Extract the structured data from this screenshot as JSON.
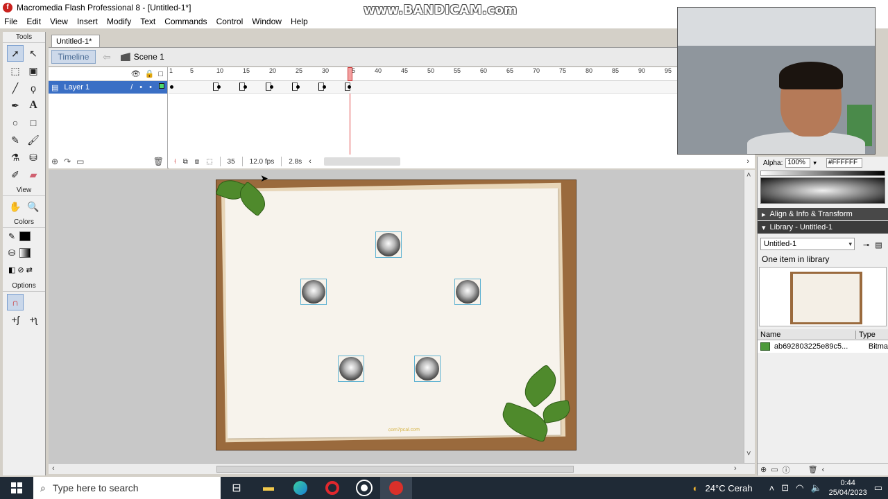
{
  "window": {
    "title": "Macromedia Flash Professional 8 - [Untitled-1*]",
    "watermark": "www.BANDICAM.com"
  },
  "menu": [
    "File",
    "Edit",
    "View",
    "Insert",
    "Modify",
    "Text",
    "Commands",
    "Control",
    "Window",
    "Help"
  ],
  "tools": {
    "label": "Tools",
    "view_label": "View",
    "colors_label": "Colors",
    "options_label": "Options"
  },
  "document": {
    "tab": "Untitled-1*",
    "timeline_button": "Timeline",
    "scene": "Scene 1"
  },
  "timeline": {
    "layer_name": "Layer 1",
    "ruler": [
      "1",
      "5",
      "10",
      "15",
      "20",
      "25",
      "30",
      "35",
      "40",
      "45",
      "50",
      "55",
      "60",
      "65",
      "70",
      "75",
      "80",
      "85",
      "90",
      "95"
    ],
    "current_frame": "35",
    "frame_rate": "12.0 fps",
    "elapsed": "2.8s"
  },
  "stage": {
    "footer_text": "com7pcal.com",
    "ball_count": 5
  },
  "properties": {
    "alpha_label": "Alpha:",
    "alpha_value": "100%",
    "hex_value": "#FFFFFF"
  },
  "panels": {
    "align_info_transform": "Align & Info & Transform",
    "library_title": "Library - Untitled-1",
    "library_select": "Untitled-1",
    "library_count": "One item in library",
    "col_name": "Name",
    "col_type": "Type",
    "item_name": "ab692803225e89c5...",
    "item_type": "Bitma"
  },
  "taskbar": {
    "search_placeholder": "Type here to search",
    "weather": "24°C  Cerah",
    "time": "0:44",
    "date": "25/04/2023"
  }
}
